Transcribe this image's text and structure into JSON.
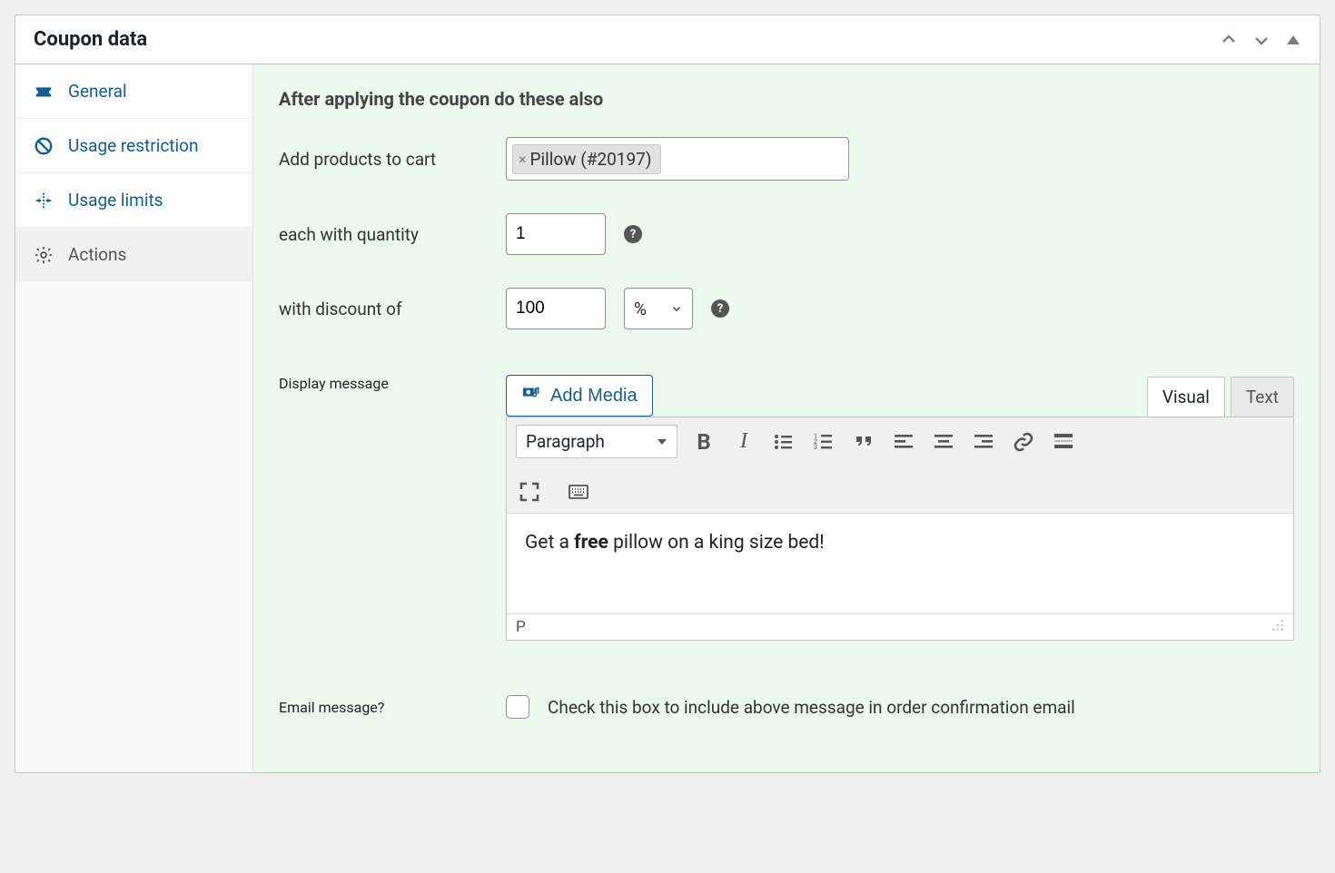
{
  "panel": {
    "title": "Coupon data"
  },
  "sidebar": {
    "tabs": [
      {
        "label": "General"
      },
      {
        "label": "Usage restriction"
      },
      {
        "label": "Usage limits"
      },
      {
        "label": "Actions"
      }
    ]
  },
  "actions": {
    "heading": "After applying the coupon do these also",
    "add_products_label": "Add products to cart",
    "product_chip": "Pillow (#20197)",
    "quantity_label": "each with quantity",
    "quantity_value": "1",
    "discount_label": "with discount of",
    "discount_value": "100",
    "discount_unit": "%",
    "display_message_label": "Display message",
    "add_media_label": "Add Media",
    "visual_tab": "Visual",
    "text_tab": "Text",
    "format_select": "Paragraph",
    "message_prefix": "Get a ",
    "message_bold": "free",
    "message_suffix": " pillow on a king size bed!",
    "path_indicator": "P",
    "email_label": "Email message?",
    "email_checkbox_label": "Check this box to include above message in order confirmation email"
  }
}
